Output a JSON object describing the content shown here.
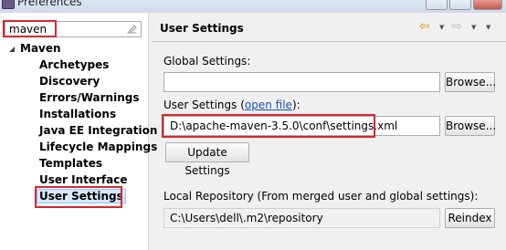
{
  "window": {
    "title": "Preferences"
  },
  "filter": {
    "value": "maven"
  },
  "tree": {
    "root": "Maven",
    "items": [
      "Archetypes",
      "Discovery",
      "Errors/Warnings",
      "Installations",
      "Java EE Integration",
      "Lifecycle Mappings",
      "Templates",
      "User Interface",
      "User Settings"
    ]
  },
  "page": {
    "title": "User Settings",
    "global_settings_label": "Global Settings:",
    "global_settings_value": "",
    "user_settings_label_prefix": "User Settings (",
    "open_file_link": "open file",
    "user_settings_label_suffix": "):",
    "user_settings_value": "D:\\apache-maven-3.5.0\\conf\\settings.xml",
    "browse_label": "Browse...",
    "update_settings_label": "Update Settings",
    "local_repo_label": "Local Repository (From merged user and global settings):",
    "local_repo_value": "C:\\Users\\dell\\.m2\\repository",
    "reindex_label": "Reindex"
  },
  "colors": {
    "highlight_border": "#d9262f",
    "selection": "#d6e8fb",
    "link": "#1a4fb5"
  }
}
